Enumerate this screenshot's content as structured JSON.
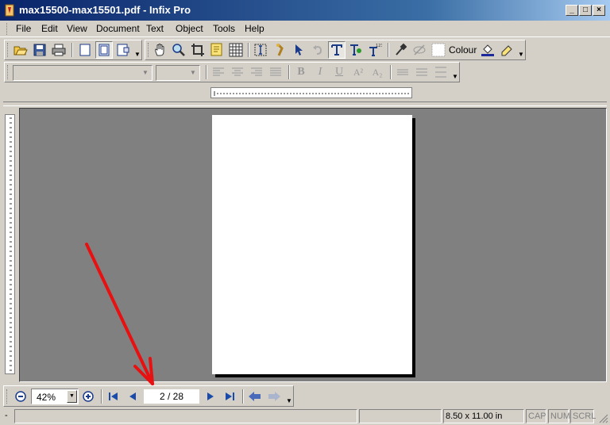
{
  "window": {
    "title": "max15500-max15501.pdf - Infix Pro",
    "minimize": "_",
    "restore": "□",
    "close": "×"
  },
  "menu": [
    "File",
    "Edit",
    "View",
    "Document",
    "Text",
    "Object",
    "Tools",
    "Help"
  ],
  "toolbar1": {
    "colour_label": "Colour",
    "icons": [
      "open-icon",
      "save-icon",
      "print-icon",
      "single-page-icon",
      "fit-page-icon",
      "two-page-icon",
      "hand-icon",
      "zoom-icon",
      "crop-icon",
      "note-icon",
      "grid-icon",
      "text-frame-icon",
      "link-icon",
      "select-icon",
      "undo-icon",
      "text-tool-icon",
      "text-edit-icon",
      "text-number-icon",
      "eyedropper-icon",
      "hide-icon",
      "colour-swatch-icon",
      "fill-icon",
      "eraser-icon"
    ]
  },
  "toolbar2": {
    "font": "",
    "size": "",
    "bold": "B",
    "italic": "I",
    "underline": "U",
    "superscript": "A²",
    "subscript": "A₂"
  },
  "navigation": {
    "zoom": "42%",
    "page_indicator": "2 / 28"
  },
  "status": {
    "left": "-",
    "page_size": "8.50 x 11.00 in",
    "cap": "CAP",
    "num": "NUM",
    "scrl": "SCRL"
  },
  "annotation": {
    "type": "red-arrow",
    "color": "#e81010",
    "points_to": "page-indicator"
  }
}
